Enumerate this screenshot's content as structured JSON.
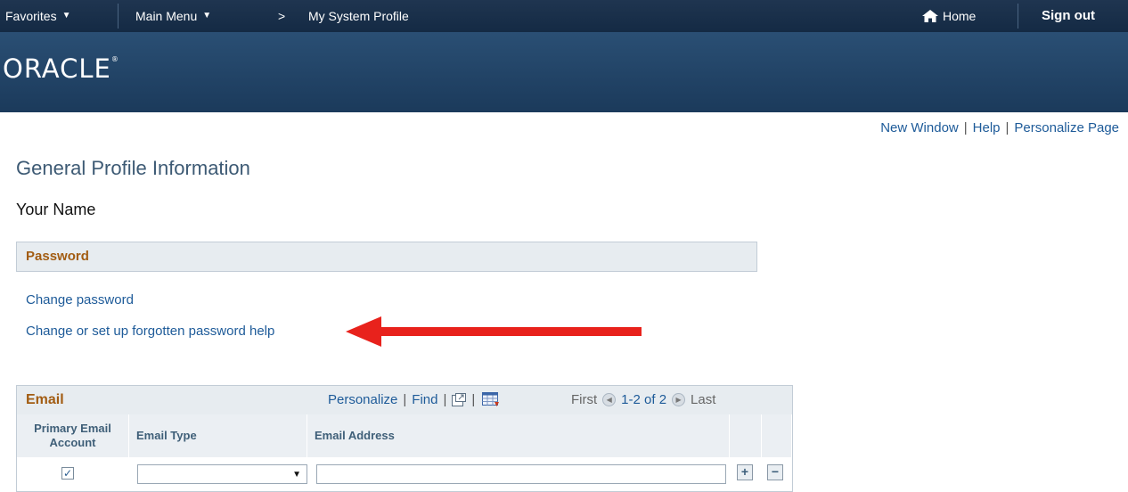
{
  "topbar": {
    "favorites": "Favorites",
    "main_menu": "Main Menu",
    "breadcrumb_sep": ">",
    "breadcrumb_current": "My System Profile",
    "home": "Home",
    "sign_out": "Sign out"
  },
  "brand": {
    "logo_text": "ORACLE",
    "logo_mark": "®"
  },
  "page_links": {
    "new_window": "New Window",
    "help": "Help",
    "personalize_page": "Personalize Page"
  },
  "page": {
    "title": "General Profile Information",
    "your_name": "Your Name",
    "password_section": "Password",
    "change_password": "Change password",
    "forgotten_password_help": "Change or set up forgotten password help"
  },
  "email_grid": {
    "title": "Email",
    "personalize": "Personalize",
    "find": "Find",
    "first": "First",
    "range": "1-2 of 2",
    "last": "Last",
    "columns": [
      "Primary Email Account",
      "Email Type",
      "Email Address"
    ],
    "row": {
      "primary_checked": true,
      "email_type": "",
      "email_address": ""
    }
  },
  "colors": {
    "annotation_arrow": "#e8221c",
    "link": "#1e5b99",
    "section_title": "#a25c12"
  }
}
